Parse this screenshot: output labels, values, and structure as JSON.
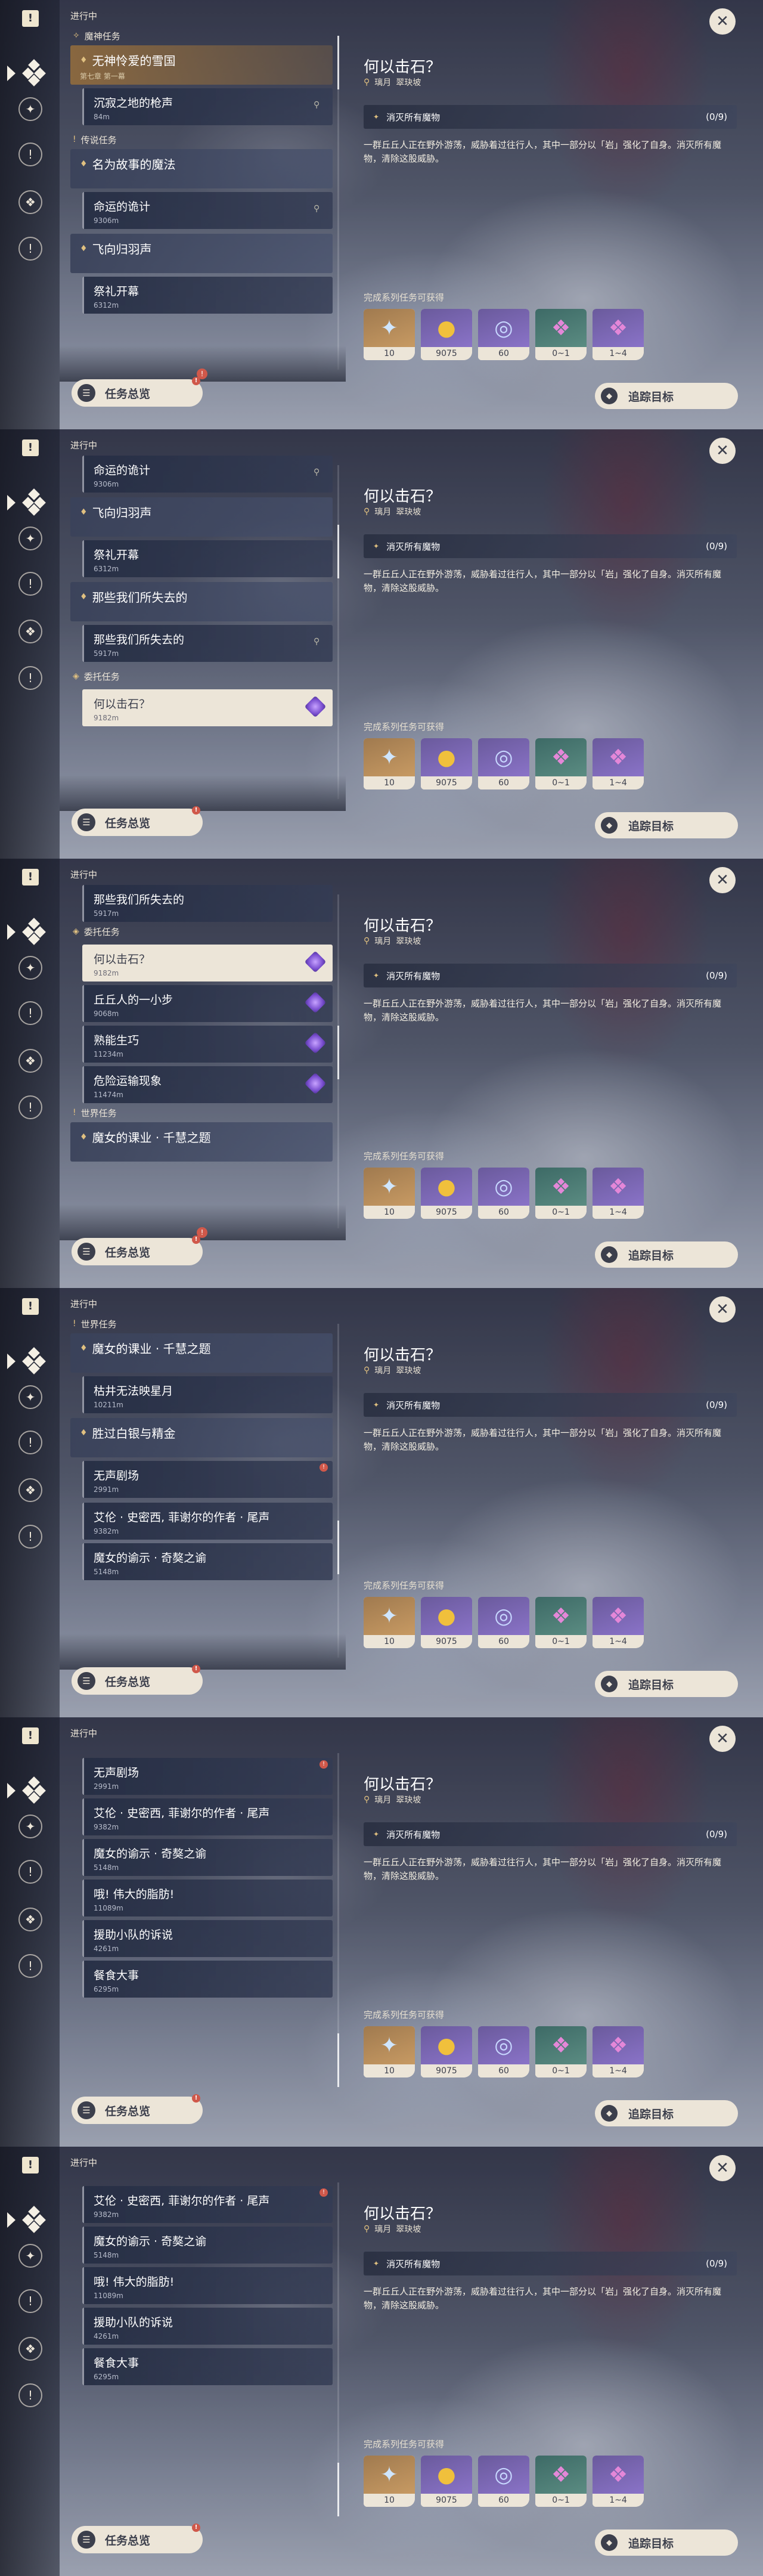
{
  "header": {
    "in_progress": "进行中"
  },
  "buttons": {
    "overview": "任务总览",
    "track": "追踪目标",
    "close": "✕"
  },
  "badge": "!",
  "categories": {
    "archon": "魔神任务",
    "legend": "传说任务",
    "commission": "委托任务",
    "world": "世界任务"
  },
  "quests": {
    "snow": {
      "title": "无神怜爱的雪国",
      "sub": "第七章 第一幕"
    },
    "silence": {
      "title": "沉寂之地的枪声",
      "dist": "84m"
    },
    "magic": {
      "title": "名为故事的魔法",
      "sub": ""
    },
    "fate": {
      "title": "命运的诡计",
      "dist": "9306m"
    },
    "feather": {
      "title": "飞向归羽声",
      "sub": ""
    },
    "ritual": {
      "title": "祭礼开幕",
      "dist": "6312m"
    },
    "lost": {
      "title": "那些我们所失去的",
      "sub": ""
    },
    "lost_step": {
      "title": "那些我们所失去的",
      "dist": "5917m"
    },
    "strike": {
      "title": "何以击石？",
      "dist": "9182m"
    },
    "hill": {
      "title": "丘丘人的一小步",
      "dist": "9068m"
    },
    "skill": {
      "title": "熟能生巧",
      "dist": "11234m"
    },
    "danger": {
      "title": "危险运输现象",
      "dist": "11474m"
    },
    "witch": {
      "title": "魔女的课业 · 千慧之题"
    },
    "starry": {
      "title": "枯井无法映星月",
      "dist": "10211m"
    },
    "silver": {
      "title": "胜过白银与精金"
    },
    "silent_theater": {
      "title": "无声剧场",
      "dist": "2991m"
    },
    "ailun": {
      "title": "艾伦 · 史密西, 菲谢尔的作者 · 尾声",
      "dist": "9382m"
    },
    "witch_note": {
      "title": "魔女的谕示 · 奇獒之谕",
      "dist": "5148m"
    },
    "great": {
      "title": "哦! 伟大的脂肪!",
      "dist": "11089m"
    },
    "rescue": {
      "title": "援助小队的诉说",
      "dist": "4261m"
    },
    "meal": {
      "title": "餐食大事",
      "dist": "6295m"
    }
  },
  "detail": {
    "title": "何以击石？",
    "location_region": "璃月",
    "location_place": "翠玦坡",
    "objective": "消灭所有魔物",
    "progress": "(0/9)",
    "description": "一群丘丘人正在野外游荡，威胁着过往行人，其中一部分以「岩」强化了自身。消灭所有魔物，清除这股威胁。",
    "rewards_label": "完成系列任务可获得",
    "rewards": [
      {
        "icon": "crystal-star-icon",
        "qty": "10"
      },
      {
        "icon": "mora-coin-icon",
        "qty": "9075"
      },
      {
        "icon": "exp-scroll-icon",
        "qty": "60"
      },
      {
        "icon": "pink-crystal-icon",
        "qty": "0~1"
      },
      {
        "icon": "pink-crystal-icon",
        "qty": "1~4"
      }
    ]
  },
  "colors": {
    "accent": "#ece5d8",
    "badge": "#d0584a",
    "pin": "#e0c080"
  }
}
